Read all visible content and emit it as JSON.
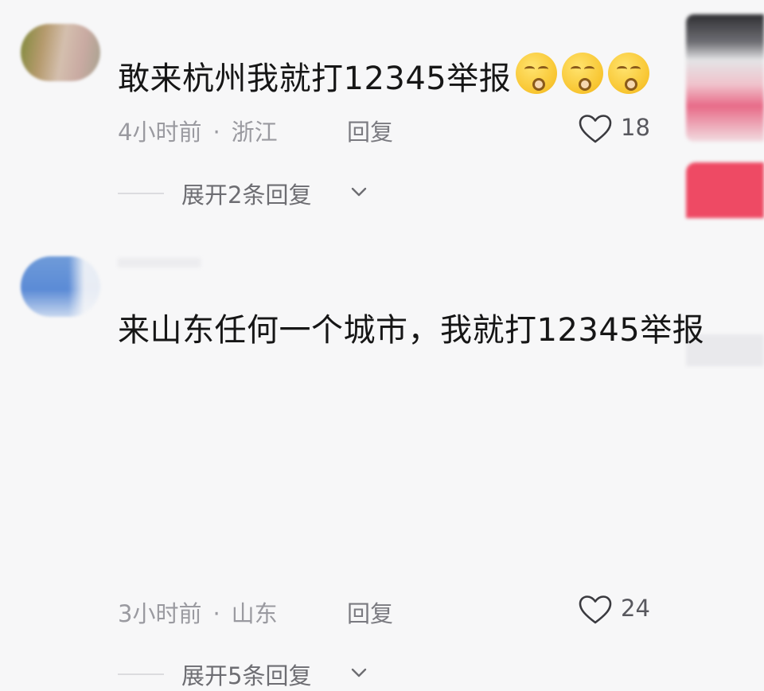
{
  "comments": [
    {
      "text": "敢来杭州我就打12345举报",
      "emojis": [
        "smirk-emoji",
        "smirk-emoji",
        "smirk-emoji"
      ],
      "time": "4小时前",
      "location": "浙江",
      "reply_label": "回复",
      "likes": "18",
      "expand_label": "展开2条回复"
    },
    {
      "text": "来山东任何一个城市，我就打12345举报",
      "time": "3小时前",
      "location": "山东",
      "reply_label": "回复",
      "likes": "24",
      "expand_label": "展开5条回复"
    }
  ],
  "separator": "·",
  "colors": {
    "heart_outline": "#3a3a3f",
    "meta_text": "#9a9aa0",
    "background": "#f7f7f8"
  }
}
